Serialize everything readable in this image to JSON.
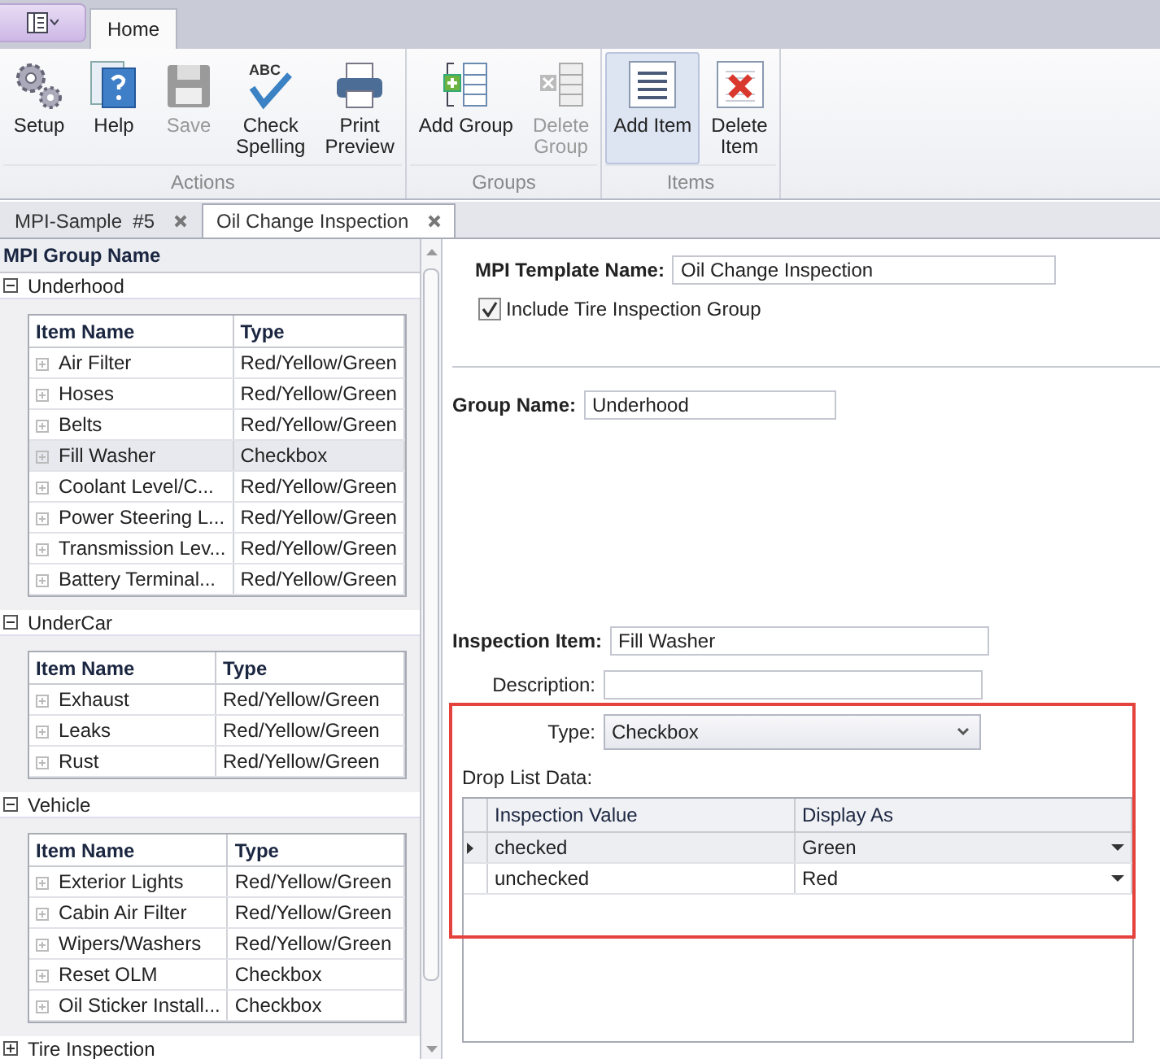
{
  "ribbon_tabs": [
    {
      "label": "Home",
      "selected": true
    }
  ],
  "ribbon": {
    "groups": [
      {
        "label": "Actions",
        "buttons": [
          {
            "label": "Setup",
            "disabled": false,
            "selected": false
          },
          {
            "label": "Help",
            "disabled": false,
            "selected": false
          },
          {
            "label": "Save",
            "disabled": true,
            "selected": false
          },
          {
            "label": "Check\nSpelling",
            "icon_text": "ABC",
            "disabled": false,
            "selected": false
          },
          {
            "label": "Print\nPreview",
            "disabled": false,
            "selected": false
          }
        ]
      },
      {
        "label": "Groups",
        "buttons": [
          {
            "label": "Add Group",
            "disabled": false,
            "selected": false
          },
          {
            "label": "Delete\nGroup",
            "disabled": true,
            "selected": false
          }
        ]
      },
      {
        "label": "Items",
        "buttons": [
          {
            "label": "Add Item",
            "disabled": false,
            "selected": true
          },
          {
            "label": "Delete\nItem",
            "disabled": false,
            "selected": false
          }
        ]
      }
    ]
  },
  "doc_tabs": [
    {
      "label": "MPI-Sample  #5",
      "selected": false
    },
    {
      "label": "Oil Change Inspection",
      "selected": true
    }
  ],
  "group_list": {
    "header": "MPI Group Name",
    "groups": [
      {
        "name": "Underhood",
        "expanded": true,
        "columns": [
          "Item Name",
          "Type"
        ],
        "items": [
          {
            "name": "Air Filter",
            "type": "Red/Yellow/Green",
            "selected": false
          },
          {
            "name": "Hoses",
            "type": "Red/Yellow/Green",
            "selected": false
          },
          {
            "name": "Belts",
            "type": "Red/Yellow/Green",
            "selected": false
          },
          {
            "name": "Fill Washer",
            "type": "Checkbox",
            "selected": true
          },
          {
            "name": "Coolant Level/C...",
            "type": "Red/Yellow/Green",
            "selected": false
          },
          {
            "name": "Power Steering L...",
            "type": "Red/Yellow/Green",
            "selected": false
          },
          {
            "name": "Transmission Lev...",
            "type": "Red/Yellow/Green",
            "selected": false
          },
          {
            "name": "Battery Terminal...",
            "type": "Red/Yellow/Green",
            "selected": false
          }
        ]
      },
      {
        "name": "UnderCar",
        "expanded": true,
        "columns": [
          "Item Name",
          "Type"
        ],
        "items": [
          {
            "name": "Exhaust",
            "type": "Red/Yellow/Green",
            "selected": false
          },
          {
            "name": "Leaks",
            "type": "Red/Yellow/Green",
            "selected": false
          },
          {
            "name": "Rust",
            "type": "Red/Yellow/Green",
            "selected": false
          }
        ]
      },
      {
        "name": "Vehicle",
        "expanded": true,
        "columns": [
          "Item Name",
          "Type"
        ],
        "items": [
          {
            "name": "Exterior Lights",
            "type": "Red/Yellow/Green",
            "selected": false
          },
          {
            "name": "Cabin Air Filter",
            "type": "Red/Yellow/Green",
            "selected": false
          },
          {
            "name": "Wipers/Washers",
            "type": "Red/Yellow/Green",
            "selected": false
          },
          {
            "name": "Reset OLM",
            "type": "Checkbox",
            "selected": false
          },
          {
            "name": "Oil Sticker Install...",
            "type": "Checkbox",
            "selected": false
          }
        ]
      },
      {
        "name": "Tire Inspection",
        "expanded": false
      }
    ]
  },
  "form": {
    "template_name": {
      "label": "MPI Template Name:",
      "value": "Oil Change Inspection"
    },
    "include_tire": {
      "label": "Include Tire Inspection Group",
      "checked": true
    },
    "group_name": {
      "label": "Group Name:",
      "value": "Underhood"
    },
    "inspection_item": {
      "label": "Inspection Item:",
      "value": "Fill Washer"
    },
    "description": {
      "label": "Description:"
    },
    "type": {
      "label": "Type:",
      "value": "Checkbox"
    },
    "drop_list": {
      "label": "Drop List Data:",
      "columns": [
        "Inspection Value",
        "Display As"
      ],
      "rows": [
        {
          "value": "checked",
          "display": "Green",
          "selected": true
        },
        {
          "value": "unchecked",
          "display": "Red",
          "selected": false
        }
      ]
    }
  }
}
